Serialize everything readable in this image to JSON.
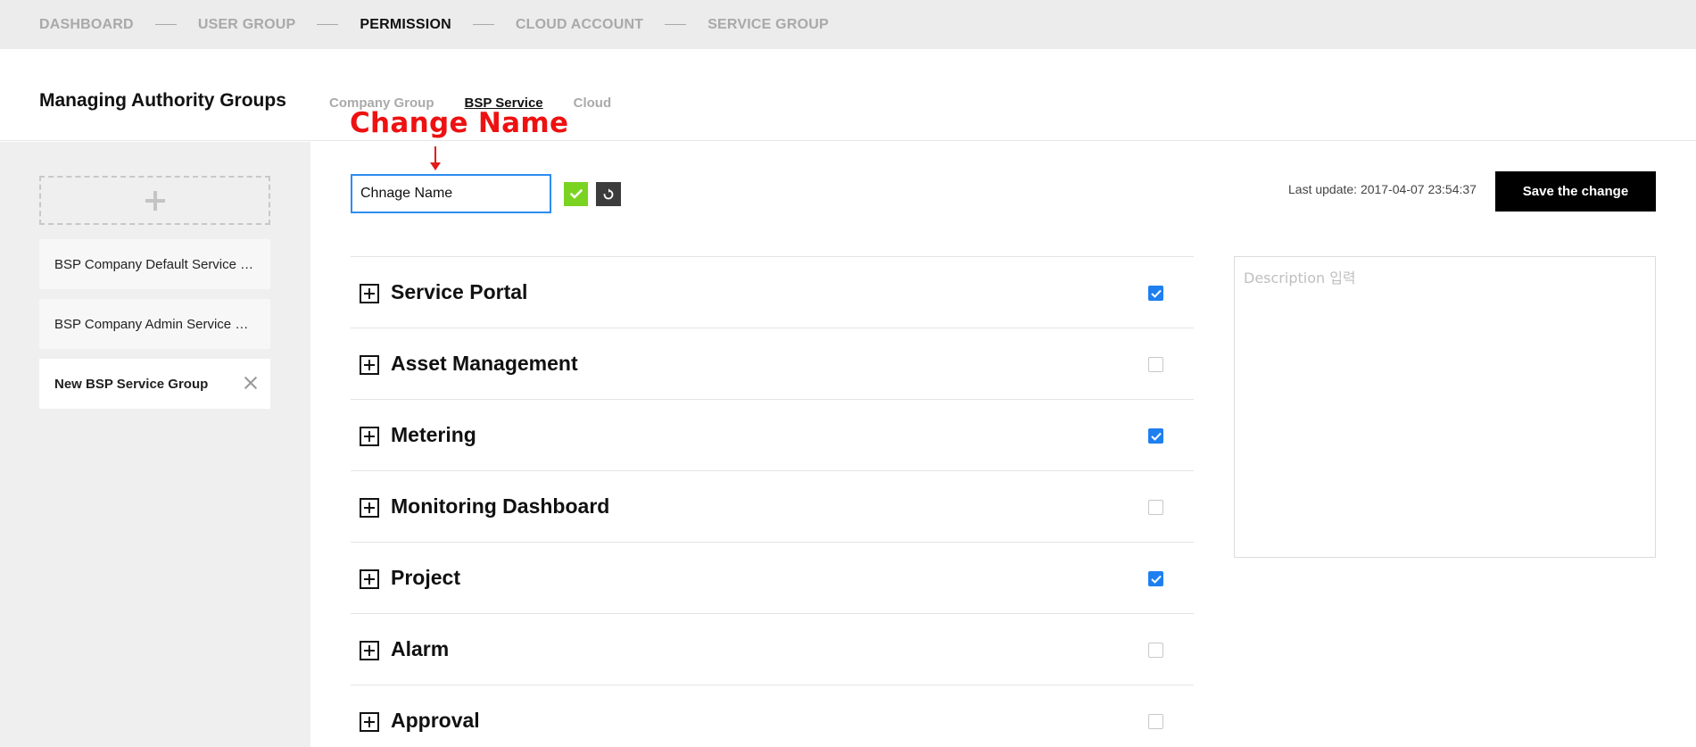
{
  "topnav": {
    "steps": [
      {
        "label": "DASHBOARD",
        "active": false
      },
      {
        "label": "USER GROUP",
        "active": false
      },
      {
        "label": "PERMISSION",
        "active": true
      },
      {
        "label": "CLOUD ACCOUNT",
        "active": false
      },
      {
        "label": "SERVICE GROUP",
        "active": false
      }
    ]
  },
  "header": {
    "title": "Managing Authority Groups",
    "tabs": [
      {
        "label": "Company Group",
        "active": false
      },
      {
        "label": "BSP Service",
        "active": true
      },
      {
        "label": "Cloud",
        "active": false
      }
    ]
  },
  "sidebar": {
    "add_icon": "plus-icon",
    "groups": [
      {
        "label": "BSP Company Default Service Group",
        "selected": false
      },
      {
        "label": "BSP Company Admin Service Group",
        "selected": false
      },
      {
        "label": "New BSP Service Group",
        "selected": true
      }
    ]
  },
  "annotation": {
    "text": "Change Name",
    "color": "#ee1111"
  },
  "editor": {
    "name_value": "Chnage Name",
    "confirm_icon": "check-icon",
    "reset_icon": "refresh-icon",
    "last_update": "Last update: 2017-04-07 23:54:37",
    "save_label": "Save the change",
    "description_placeholder": "Description 입력"
  },
  "permissions": [
    {
      "name": "Service Portal",
      "checked": true
    },
    {
      "name": "Asset Management",
      "checked": false
    },
    {
      "name": "Metering",
      "checked": true
    },
    {
      "name": "Monitoring Dashboard",
      "checked": false
    },
    {
      "name": "Project",
      "checked": true
    },
    {
      "name": "Alarm",
      "checked": false
    },
    {
      "name": "Approval",
      "checked": false
    }
  ],
  "colors": {
    "accent_blue": "#1e7ff0",
    "confirm_green": "#7bd321",
    "input_border": "#2d8cf0"
  }
}
